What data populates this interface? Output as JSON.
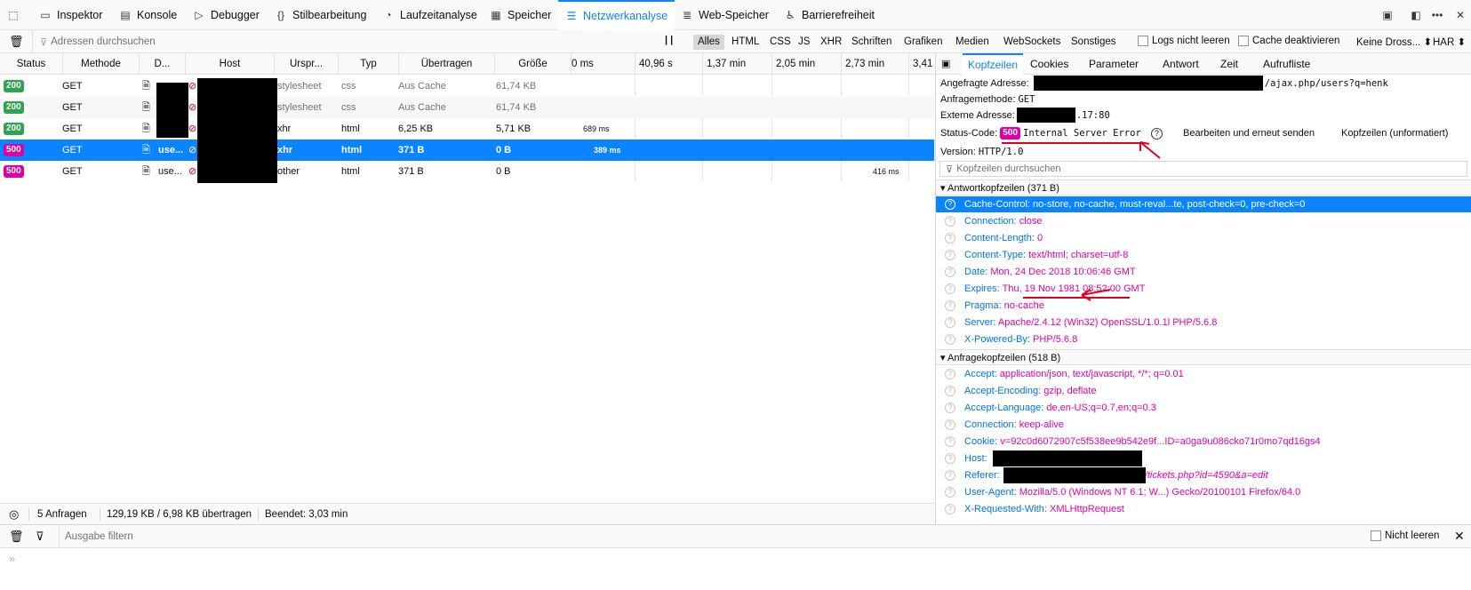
{
  "toolbar": {
    "tabs": [
      {
        "label": "Inspektor",
        "icon": "inspector-icon"
      },
      {
        "label": "Konsole",
        "icon": "console-icon"
      },
      {
        "label": "Debugger",
        "icon": "debugger-icon"
      },
      {
        "label": "Stilbearbeitung",
        "icon": "style-editor-icon"
      },
      {
        "label": "Laufzeitanalyse",
        "icon": "performance-icon"
      },
      {
        "label": "Speicher",
        "icon": "memory-icon"
      },
      {
        "label": "Netzwerkanalyse",
        "icon": "network-icon"
      },
      {
        "label": "Web-Speicher",
        "icon": "storage-icon"
      },
      {
        "label": "Barrierefreiheit",
        "icon": "accessibility-icon"
      }
    ],
    "selected_tab": "Netzwerkanalyse",
    "accent_color": "#0a84ff"
  },
  "filterbar": {
    "search_placeholder": "Adressen durchsuchen",
    "types": [
      "Alles",
      "HTML",
      "CSS",
      "JS",
      "XHR",
      "Schriften",
      "Grafiken",
      "Medien",
      "WebSockets",
      "Sonstiges"
    ],
    "active_type": "Alles",
    "persist_logs": "Logs nicht leeren",
    "disable_cache": "Cache deaktivieren",
    "throttling": "Keine Dross...",
    "har": "HAR"
  },
  "columns": [
    "Status",
    "Methode",
    "D...",
    "Host",
    "Urspr...",
    "Typ",
    "Übertragen",
    "Größe"
  ],
  "waterfall_ticks": [
    "0 ms",
    "40,96 s",
    "1,37 min",
    "2,05 min",
    "2,73 min",
    "3,41"
  ],
  "requests": [
    {
      "status": "200",
      "method": "GET",
      "file": "",
      "cause": "stylesheet",
      "type": "css",
      "transferred": "Aus Cache",
      "size": "61,74 KB",
      "time": ""
    },
    {
      "status": "200",
      "method": "GET",
      "file": "",
      "cause": "stylesheet",
      "type": "css",
      "transferred": "Aus Cache",
      "size": "61,74 KB",
      "time": ""
    },
    {
      "status": "200",
      "method": "GET",
      "file": "",
      "cause": "xhr",
      "type": "html",
      "transferred": "6,25 KB",
      "size": "5,71 KB",
      "time": "689 ms"
    },
    {
      "status": "500",
      "method": "GET",
      "file": "use...",
      "cause": "xhr",
      "type": "html",
      "transferred": "371 B",
      "size": "0 B",
      "time": "389 ms"
    },
    {
      "status": "500",
      "method": "GET",
      "file": "use...",
      "cause": "other",
      "type": "html",
      "transferred": "371 B",
      "size": "0 B",
      "time": "416 ms"
    }
  ],
  "status_colors": {
    "ok": "#2ea44f",
    "error": "#dd00a9"
  },
  "statusbar": {
    "requests": "5 Anfragen",
    "transferred": "129,19 KB / 6,98 KB übertragen",
    "finished": "Beendet: 3,03 min"
  },
  "details": {
    "tabs": [
      "Kopfzeilen",
      "Cookies",
      "Parameter",
      "Antwort",
      "Zeit",
      "Aufrufliste"
    ],
    "active_tab": "Kopfzeilen",
    "url_label": "Angefragte Adresse:",
    "url_value": "/ajax.php/users?q=henk",
    "method_label": "Anfragemethode:",
    "method_value": "GET",
    "remote_label": "Externe Adresse:",
    "remote_value": ".17:80",
    "status_label": "Status-Code:",
    "status_code": "500",
    "status_text": "Internal Server Error",
    "edit_resend": "Bearbeiten und erneut senden",
    "raw_headers": "Kopfzeilen (unformatiert)",
    "version_label": "Version:",
    "version_value": "HTTP/1.0",
    "filter_placeholder": "Kopfzeilen durchsuchen",
    "response_section": "Antwortkopfzeilen (371 B)",
    "response_headers": [
      {
        "k": "Cache-Control:",
        "v": "no-store, no-cache, must-reval...te, post-check=0, pre-check=0"
      },
      {
        "k": "Connection:",
        "v": "close"
      },
      {
        "k": "Content-Length:",
        "v": "0"
      },
      {
        "k": "Content-Type:",
        "v": "text/html; charset=utf-8"
      },
      {
        "k": "Date:",
        "v": "Mon, 24 Dec 2018 10:06:46 GMT"
      },
      {
        "k": "Expires:",
        "v": "Thu, 19 Nov 1981 08:52:00 GMT"
      },
      {
        "k": "Pragma:",
        "v": "no-cache"
      },
      {
        "k": "Server:",
        "v": "Apache/2.4.12 (Win32) OpenSSL/1.0.1l PHP/5.6.8"
      },
      {
        "k": "X-Powered-By:",
        "v": "PHP/5.6.8"
      }
    ],
    "request_section": "Anfragekopfzeilen (518 B)",
    "request_headers": [
      {
        "k": "Accept:",
        "v": "application/json, text/javascript, */*; q=0.01"
      },
      {
        "k": "Accept-Encoding:",
        "v": "gzip, deflate"
      },
      {
        "k": "Accept-Language:",
        "v": "de,en-US;q=0.7,en;q=0.3"
      },
      {
        "k": "Connection:",
        "v": "keep-alive"
      },
      {
        "k": "Cookie:",
        "v": "v=92c0d6072907c5f538ee9b542e9f...ID=a0ga9u086cko71r0mo7qd16gs4"
      },
      {
        "k": "Host:",
        "v": ""
      },
      {
        "k": "Referer:",
        "v": "/tickets.php?id=4590&a=edit"
      },
      {
        "k": "User-Agent:",
        "v": "Mozilla/5.0 (Windows NT 6.1; W...) Gecko/20100101 Firefox/64.0"
      },
      {
        "k": "X-Requested-With:",
        "v": "XMLHttpRequest"
      }
    ]
  },
  "console": {
    "filter_placeholder": "Ausgabe filtern",
    "persist_logs": "Nicht leeren",
    "prompt": "»"
  }
}
